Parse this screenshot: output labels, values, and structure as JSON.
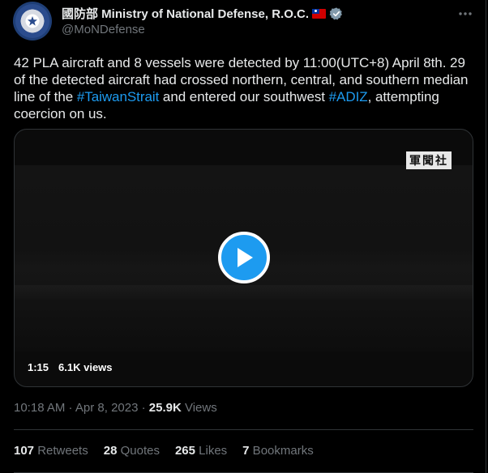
{
  "tweet": {
    "display_name": "國防部 Ministry of National Defense, R.O.C.",
    "handle": "@MoNDefense",
    "text_before_1": "42 PLA aircraft and 8 vessels were detected by 11:00(UTC+8) April 8th. 29 of the detected aircraft had crossed northern, central, and southern median line of the ",
    "hashtag_1": "#TaiwanStrait",
    "text_between": " and entered our southwest ",
    "hashtag_2": "#ADIZ",
    "text_after": ", attempting coercion on us.",
    "timestamp": "10:18 AM · Apr 8, 2023 · ",
    "views_count": "25.9K",
    "views_label": " Views"
  },
  "video": {
    "duration": "1:15",
    "views": "6.1K views",
    "watermark": "軍聞社"
  },
  "stats": [
    {
      "num": "107",
      "label": " Retweets"
    },
    {
      "num": "28",
      "label": " Quotes"
    },
    {
      "num": "265",
      "label": " Likes"
    },
    {
      "num": "7",
      "label": " Bookmarks"
    }
  ],
  "colors": {
    "accent": "#1d9bf0",
    "text_primary": "#e7e9ea",
    "text_secondary": "#71767b",
    "border": "#2f3336",
    "background": "#000000"
  },
  "icons": {
    "verified": "verified-badge-icon",
    "more": "more-dots-icon",
    "play": "play-icon",
    "flag": "taiwan-flag-icon"
  }
}
